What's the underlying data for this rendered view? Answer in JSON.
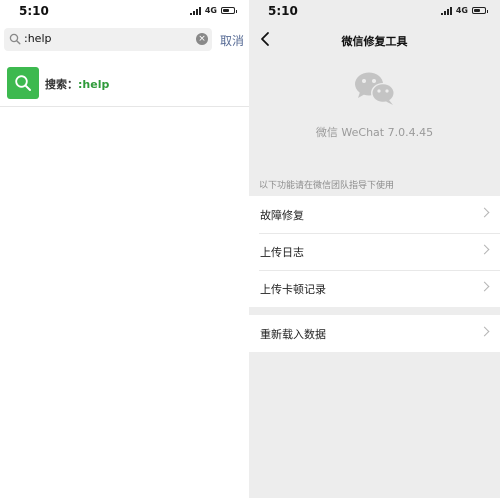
{
  "left": {
    "status": {
      "time": "5:10",
      "network": "4G"
    },
    "search": {
      "value": ":help",
      "clear_icon": "×"
    },
    "cancel_label": "取消",
    "result": {
      "prefix": "搜索：",
      "query": ":help"
    },
    "colors": {
      "accent_green": "#3db94f",
      "link_blue": "#576b95"
    }
  },
  "right": {
    "status": {
      "time": "5:10",
      "network": "4G"
    },
    "title": "微信修复工具",
    "version": "微信 WeChat 7.0.4.45",
    "hint": "以下功能请在微信团队指导下使用",
    "menu_group1": [
      "故障修复",
      "上传日志",
      "上传卡顿记录"
    ],
    "menu_group2": [
      "重新载入数据"
    ]
  }
}
